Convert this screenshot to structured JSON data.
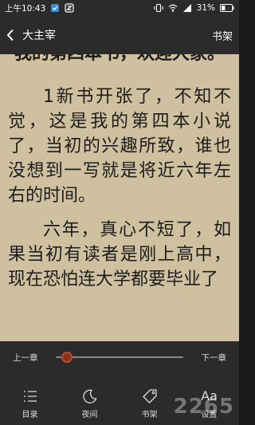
{
  "status_bar": {
    "time": "上午10:43",
    "battery": "31%"
  },
  "nav": {
    "book_title": "大主宰",
    "shelf_label": "书架"
  },
  "reader": {
    "chapter_title": "我的第四本书，欢迎大家。",
    "paragraphs": [
      "1新书开张了，不知不觉，这是我的第四本小说了，当初的兴趣所致，谁也没想到一写就是将近六年左右的时间。",
      "六年，真心不短了，如果当初有读者是刚上高中，现在恐怕连大学都要毕业了"
    ]
  },
  "controls": {
    "prev_chapter": "上一章",
    "next_chapter": "下一章",
    "progress": 0.05,
    "tabs": [
      {
        "label": "目录",
        "icon": "list-icon"
      },
      {
        "label": "夜间",
        "icon": "moon-icon"
      },
      {
        "label": "书架",
        "icon": "tag-icon"
      },
      {
        "label": "设置",
        "icon": "font-settings-icon",
        "glyph": "Aa"
      }
    ]
  },
  "watermark": "2265",
  "colors": {
    "bars": "#2b2b2b",
    "page": "#cfc0a0",
    "slider_thumb": "#8a2e1e"
  }
}
